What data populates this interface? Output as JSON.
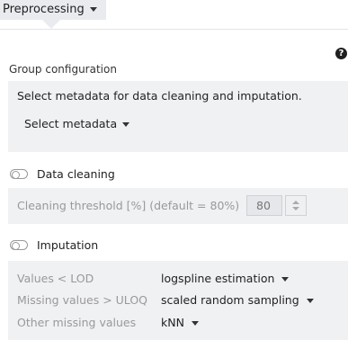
{
  "header": {
    "tab_label": "Preprocessing"
  },
  "help": {
    "symbol": "?"
  },
  "group_config": {
    "title": "Group configuration",
    "description": "Select metadata for data cleaning and imputation.",
    "select_label": "Select metadata"
  },
  "data_cleaning": {
    "toggle_label": "Data cleaning",
    "enabled": false,
    "threshold_label": "Cleaning threshold [%] (default = 80%)",
    "threshold_value": "80"
  },
  "imputation": {
    "toggle_label": "Imputation",
    "enabled": false,
    "rows": [
      {
        "label": "Values < LOD",
        "value": "logspline estimation"
      },
      {
        "label": "Missing values > ULOQ",
        "value": "scaled random sampling"
      },
      {
        "label": "Other missing values",
        "value": "kNN"
      }
    ]
  }
}
